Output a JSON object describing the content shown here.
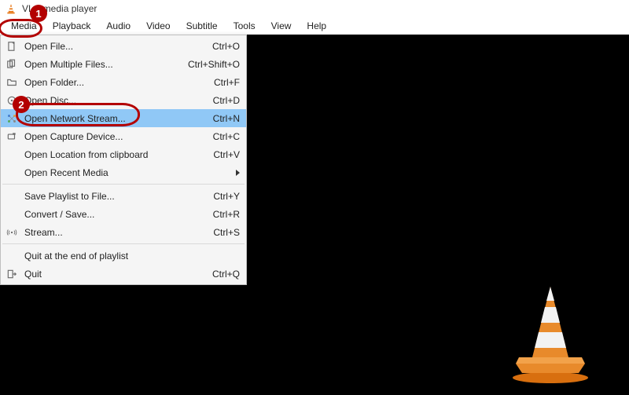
{
  "title": "VLC media player",
  "menubar": [
    "Media",
    "Playback",
    "Audio",
    "Video",
    "Subtitle",
    "Tools",
    "View",
    "Help"
  ],
  "callouts": {
    "one": "1",
    "two": "2"
  },
  "dropdown": {
    "groups": [
      [
        {
          "icon": "file-icon",
          "label": "Open File...",
          "shortcut": "Ctrl+O"
        },
        {
          "icon": "files-icon",
          "label": "Open Multiple Files...",
          "shortcut": "Ctrl+Shift+O"
        },
        {
          "icon": "folder-icon",
          "label": "Open Folder...",
          "shortcut": "Ctrl+F"
        },
        {
          "icon": "disc-icon",
          "label": "Open Disc...",
          "shortcut": "Ctrl+D"
        },
        {
          "icon": "network-icon",
          "label": "Open Network Stream...",
          "shortcut": "Ctrl+N",
          "highlight": true
        },
        {
          "icon": "capture-icon",
          "label": "Open Capture Device...",
          "shortcut": "Ctrl+C"
        },
        {
          "icon": "",
          "label": "Open Location from clipboard",
          "shortcut": "Ctrl+V"
        },
        {
          "icon": "",
          "label": "Open Recent Media",
          "submenu": true
        }
      ],
      [
        {
          "icon": "",
          "label": "Save Playlist to File...",
          "shortcut": "Ctrl+Y"
        },
        {
          "icon": "",
          "label": "Convert / Save...",
          "shortcut": "Ctrl+R"
        },
        {
          "icon": "stream-icon",
          "label": "Stream...",
          "shortcut": "Ctrl+S"
        }
      ],
      [
        {
          "icon": "",
          "label": "Quit at the end of playlist"
        },
        {
          "icon": "quit-icon",
          "label": "Quit",
          "shortcut": "Ctrl+Q"
        }
      ]
    ]
  }
}
